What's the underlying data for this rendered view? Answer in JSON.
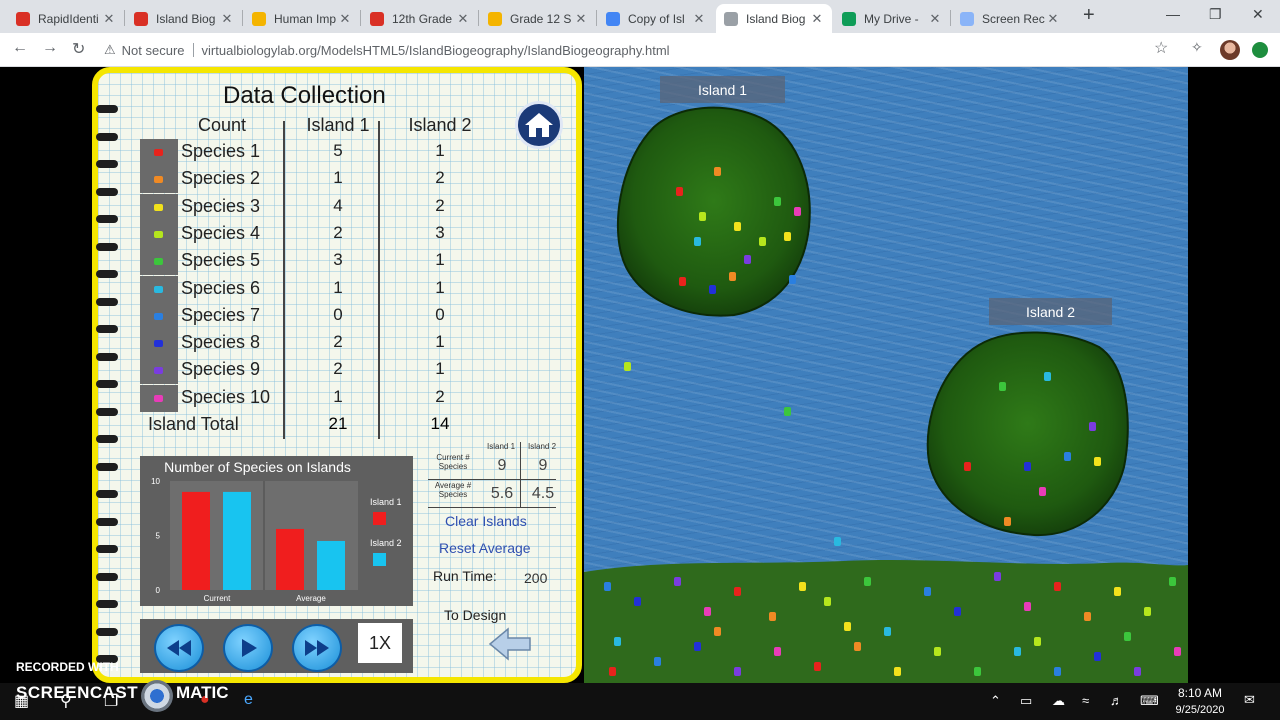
{
  "browser": {
    "tabs": [
      {
        "label": "RapidIdenti",
        "fav": "#d93025",
        "active": false
      },
      {
        "label": "Island Biog",
        "fav": "#d93025",
        "active": false
      },
      {
        "label": "Human Imp",
        "fav": "#f4b400",
        "active": false
      },
      {
        "label": "12th Grade",
        "fav": "#d93025",
        "active": false
      },
      {
        "label": "Grade 12 S",
        "fav": "#f4b400",
        "active": false
      },
      {
        "label": "Copy of Isl",
        "fav": "#4285f4",
        "active": false
      },
      {
        "label": "Island Biog",
        "fav": "#9aa0a6",
        "active": true
      },
      {
        "label": "My Drive -",
        "fav": "#0f9d58",
        "active": false
      },
      {
        "label": "Screen Rec",
        "fav": "#8ab4f8",
        "active": false
      }
    ],
    "security": "Not secure",
    "url": "virtualbiologylab.org/ModelsHTML5/IslandBiogeography/IslandBiogeography.html"
  },
  "panel": {
    "title": "Data Collection",
    "headers": {
      "count": "Count",
      "island1": "Island 1",
      "island2": "Island 2"
    },
    "species": [
      {
        "name": "Species 1",
        "i1": "5",
        "i2": "1",
        "color": "#e8231c"
      },
      {
        "name": "Species 2",
        "i1": "1",
        "i2": "2",
        "color": "#f08a24"
      },
      {
        "name": "Species 3",
        "i1": "4",
        "i2": "2",
        "color": "#f2e21c"
      },
      {
        "name": "Species 4",
        "i1": "2",
        "i2": "3",
        "color": "#b5e61d"
      },
      {
        "name": "Species 5",
        "i1": "3",
        "i2": "1",
        "color": "#3cc63c"
      },
      {
        "name": "Species 6",
        "i1": "1",
        "i2": "1",
        "color": "#29b9e0"
      },
      {
        "name": "Species 7",
        "i1": "0",
        "i2": "0",
        "color": "#2a7fe0"
      },
      {
        "name": "Species 8",
        "i1": "2",
        "i2": "1",
        "color": "#2230d8"
      },
      {
        "name": "Species 9",
        "i1": "2",
        "i2": "1",
        "color": "#7a3ce0"
      },
      {
        "name": "Species 10",
        "i1": "1",
        "i2": "2",
        "color": "#e83cb8"
      }
    ],
    "total_label": "Island Total",
    "total_i1": "21",
    "total_i2": "14",
    "stats": {
      "h1": "Island 1",
      "h2": "Island 2",
      "current_label": "Current # Species",
      "current_i1": "9",
      "current_i2": "9",
      "average_label": "Average # Species",
      "average_i1": "5.6",
      "average_i2": "4.5"
    },
    "clear_islands": "Clear Islands",
    "reset_average": "Reset Average",
    "run_time_label": "Run Time:",
    "run_time_value": "200",
    "to_design": "To Design",
    "speed": "1X"
  },
  "chart_data": {
    "type": "bar",
    "title": "Number of Species on Islands",
    "categories": [
      "Current",
      "Average"
    ],
    "series": [
      {
        "name": "Island 1",
        "values": [
          9,
          5.6
        ],
        "color": "#f01e1e"
      },
      {
        "name": "Island 2",
        "values": [
          9,
          4.5
        ],
        "color": "#18c4f0"
      }
    ],
    "yticks": [
      "0",
      "5",
      "10"
    ],
    "ylim": [
      0,
      10
    ]
  },
  "map": {
    "island1_label": "Island 1",
    "island2_label": "Island 2"
  },
  "overlay": {
    "recorded": "RECORDED WITH",
    "brand_a": "SCREENCAST",
    "brand_b": "MATIC"
  },
  "taskbar": {
    "time": "8:10 AM",
    "date": "9/25/2020"
  }
}
